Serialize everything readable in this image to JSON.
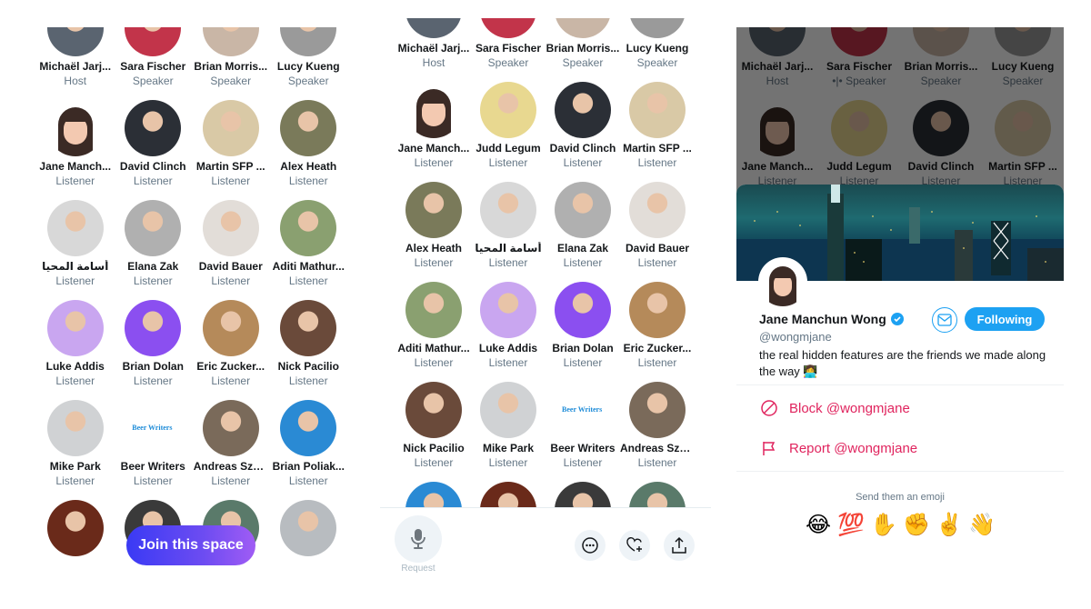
{
  "panel1": {
    "participants": [
      {
        "name": "Michaël Jarj...",
        "role": "Host",
        "color": "#5a6470"
      },
      {
        "name": "Sara Fischer",
        "role": "Speaker",
        "color": "#c2344a"
      },
      {
        "name": "Brian Morris...",
        "role": "Speaker",
        "color": "#c9b6a6"
      },
      {
        "name": "Lucy Kueng",
        "role": "Speaker",
        "color": "#9a9a9a"
      },
      {
        "name": "Jane Manch...",
        "role": "Listener",
        "color": "memoji"
      },
      {
        "name": "David Clinch",
        "role": "Listener",
        "color": "#2b2f36"
      },
      {
        "name": "Martin SFP ...",
        "role": "Listener",
        "color": "#d9c9a6"
      },
      {
        "name": "Alex Heath",
        "role": "Listener",
        "color": "#7a7a5a"
      },
      {
        "name": "أسامة المحيا",
        "role": "Listener",
        "color": "#d8d8d8"
      },
      {
        "name": "Elana Zak",
        "role": "Listener",
        "color": "#b0b0b0"
      },
      {
        "name": "David Bauer",
        "role": "Listener",
        "color": "#e2ddd8"
      },
      {
        "name": "Aditi Mathur...",
        "role": "Listener",
        "color": "#8aa070"
      },
      {
        "name": "Luke Addis",
        "role": "Listener",
        "color": "#c9a6f0"
      },
      {
        "name": "Brian Dolan",
        "role": "Listener",
        "color": "#8b4ff0"
      },
      {
        "name": "Eric Zucker...",
        "role": "Listener",
        "color": "#b58a5a"
      },
      {
        "name": "Nick Pacilio",
        "role": "Listener",
        "color": "#6a4a3a"
      },
      {
        "name": "Mike Park",
        "role": "Listener",
        "color": "#d0d2d4"
      },
      {
        "name": "Beer Writers",
        "role": "Listener",
        "color": "#ffffff"
      },
      {
        "name": "Andreas Sza...",
        "role": "Listener",
        "color": "#7a6a5a"
      },
      {
        "name": "Brian Poliak...",
        "role": "Listener",
        "color": "#2a8ad4"
      },
      {
        "name": "",
        "role": "",
        "color": "#6a2a1a"
      },
      {
        "name": "",
        "role": "",
        "color": "#3a3a3a"
      },
      {
        "name": "",
        "role": "",
        "color": "#5a7a6a"
      },
      {
        "name": "",
        "role": "",
        "color": "#b8bcc0"
      }
    ],
    "join_label": "Join this space"
  },
  "panel2": {
    "participants": [
      {
        "name": "Michaël Jarj...",
        "role": "Host",
        "color": "#5a6470"
      },
      {
        "name": "Sara Fischer",
        "role": "Speaker",
        "color": "#c2344a"
      },
      {
        "name": "Brian Morris...",
        "role": "Speaker",
        "color": "#c9b6a6"
      },
      {
        "name": "Lucy Kueng",
        "role": "Speaker",
        "color": "#9a9a9a"
      },
      {
        "name": "Jane Manch...",
        "role": "Listener",
        "color": "memoji"
      },
      {
        "name": "Judd Legum",
        "role": "Listener",
        "color": "#e8d890"
      },
      {
        "name": "David Clinch",
        "role": "Listener",
        "color": "#2b2f36"
      },
      {
        "name": "Martin SFP ...",
        "role": "Listener",
        "color": "#d9c9a6"
      },
      {
        "name": "Alex Heath",
        "role": "Listener",
        "color": "#7a7a5a"
      },
      {
        "name": "أسامة المحيا",
        "role": "Listener",
        "color": "#d8d8d8"
      },
      {
        "name": "Elana Zak",
        "role": "Listener",
        "color": "#b0b0b0"
      },
      {
        "name": "David Bauer",
        "role": "Listener",
        "color": "#e2ddd8"
      },
      {
        "name": "Aditi Mathur...",
        "role": "Listener",
        "color": "#8aa070"
      },
      {
        "name": "Luke Addis",
        "role": "Listener",
        "color": "#c9a6f0"
      },
      {
        "name": "Brian Dolan",
        "role": "Listener",
        "color": "#8b4ff0"
      },
      {
        "name": "Eric Zucker...",
        "role": "Listener",
        "color": "#b58a5a"
      },
      {
        "name": "Nick Pacilio",
        "role": "Listener",
        "color": "#6a4a3a"
      },
      {
        "name": "Mike Park",
        "role": "Listener",
        "color": "#d0d2d4"
      },
      {
        "name": "Beer Writers",
        "role": "Listener",
        "color": "#ffffff"
      },
      {
        "name": "Andreas Sza...",
        "role": "Listener",
        "color": "#7a6a5a"
      },
      {
        "name": "",
        "role": "",
        "color": "#2a8ad4"
      },
      {
        "name": "",
        "role": "",
        "color": "#6a2a1a"
      },
      {
        "name": "",
        "role": "",
        "color": "#3a3a3a"
      },
      {
        "name": "",
        "role": "",
        "color": "#5a7a6a"
      }
    ],
    "request_label": "Request"
  },
  "panel3": {
    "participants": [
      {
        "name": "Michaël Jarj...",
        "role": "Host",
        "color": "#5a6470"
      },
      {
        "name": "Sara Fischer",
        "role": "Speaker",
        "color": "#c2344a",
        "speaking": true
      },
      {
        "name": "Brian Morris...",
        "role": "Speaker",
        "color": "#c9b6a6"
      },
      {
        "name": "Lucy Kueng",
        "role": "Speaker",
        "color": "#9a9a9a"
      },
      {
        "name": "Jane Manch...",
        "role": "Listener",
        "color": "memoji"
      },
      {
        "name": "Judd Legum",
        "role": "Listener",
        "color": "#e8d890"
      },
      {
        "name": "David Clinch",
        "role": "Listener",
        "color": "#2b2f36"
      },
      {
        "name": "Martin SFP ...",
        "role": "Listener",
        "color": "#d9c9a6"
      }
    ],
    "profile": {
      "name": "Jane Manchun Wong",
      "handle": "@wongmjane",
      "bio": "the real hidden features are the friends we made along the way 👩‍💻",
      "follow_label": "Following",
      "block_label": "Block @wongmjane",
      "report_label": "Report @wongmjane",
      "emoji_title": "Send them an emoji",
      "emojis": [
        "😂",
        "💯",
        "✋",
        "✊",
        "✌️",
        "👋"
      ]
    }
  },
  "colors": {
    "twitter_blue": "#1da1f2",
    "danger": "#e0245e",
    "muted": "#657786"
  }
}
